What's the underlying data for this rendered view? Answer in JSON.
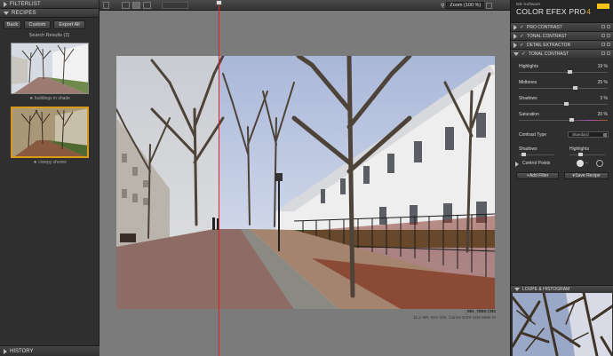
{
  "left_panel": {
    "filterlist_title": "FILTERLIST",
    "recipes_title": "RECIPES",
    "buttons": {
      "back": "Back",
      "custom": "Custom",
      "export_all": "Export All"
    },
    "search_results": "Search Results (2)",
    "thumbnails": [
      {
        "label": "buildings in shade"
      },
      {
        "label": "creepy shores"
      }
    ],
    "history_title": "HISTORY"
  },
  "toolbar": {
    "zoom_label": "Zoom (100 %)"
  },
  "image_meta": {
    "filename": "_MG_7850.CR2",
    "details": "11.2 MP, ISO 400, Canon EOS-1Ds Mark III"
  },
  "right_panel": {
    "brand_small": "Nik Software",
    "brand_title": "COLOR EFEX PRO",
    "brand_version": "4",
    "filters": [
      {
        "label": "PRO CONTRAST",
        "expanded": false
      },
      {
        "label": "TONAL CONTRAST",
        "expanded": false
      },
      {
        "label": "DETAIL EXTRACTOR",
        "expanded": false
      },
      {
        "label": "TONAL CONTRAST",
        "expanded": true
      }
    ],
    "sliders": [
      {
        "label": "Highlights",
        "value": "19 %",
        "level": 0.56
      },
      {
        "label": "Midtones",
        "value": "25 %",
        "level": 0.62
      },
      {
        "label": "Shadows",
        "value": "3 %",
        "level": 0.52
      },
      {
        "label": "Saturation",
        "value": "20 %",
        "level": 0.58
      }
    ],
    "contrast_type_label": "Contrast Type",
    "contrast_type_value": "Standard",
    "bottom_labels": {
      "shadows": "Shadows",
      "highlights": "Highlights"
    },
    "control_points_label": "Control Points",
    "add_filter": "Add Filter",
    "save_recipe": "Save Recipe",
    "loupe_title": "LOUPE & HISTOGRAM"
  }
}
